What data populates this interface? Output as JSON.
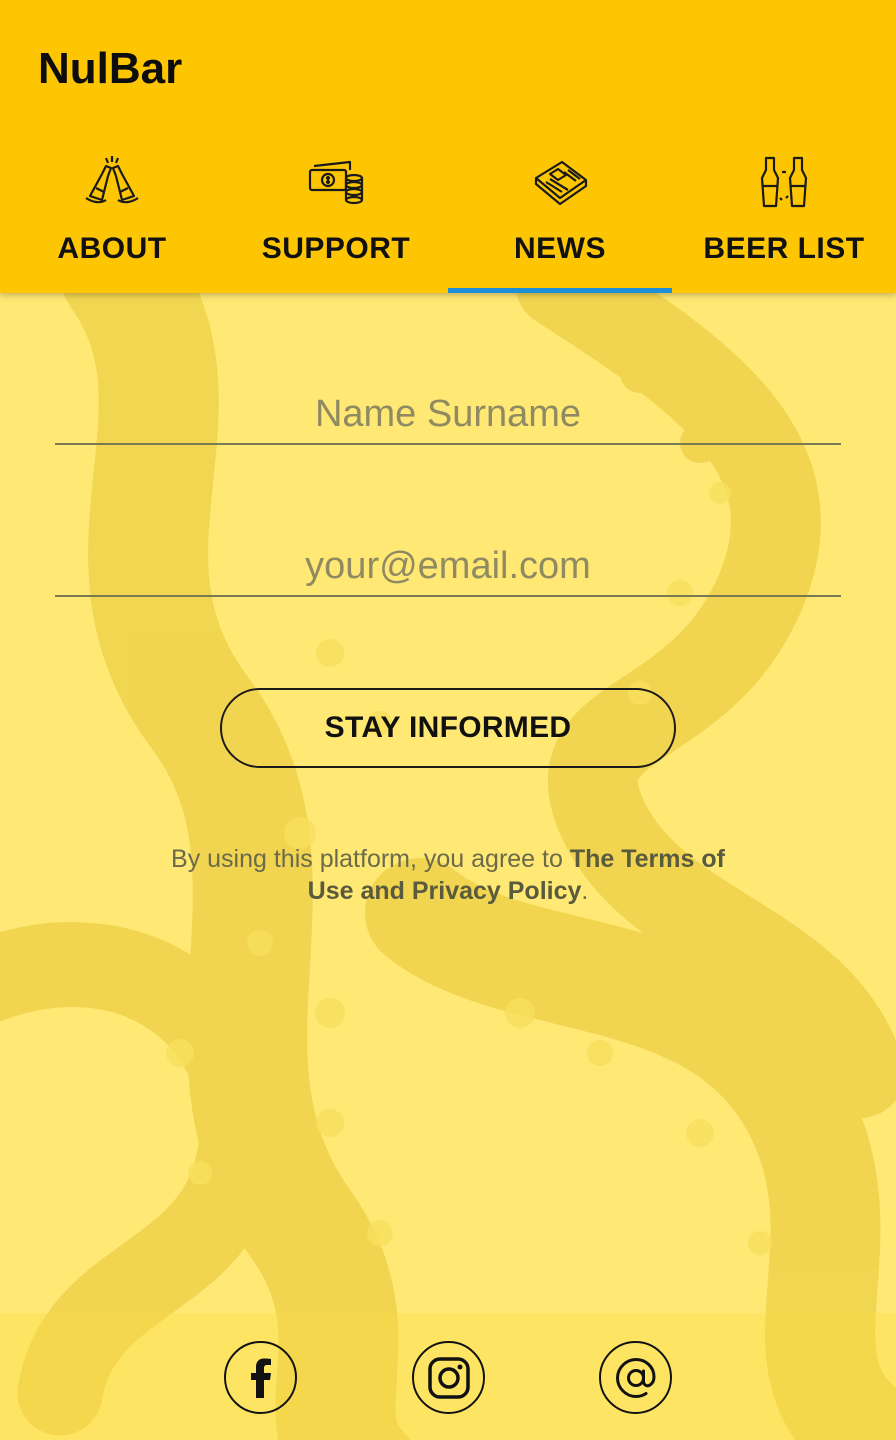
{
  "app": {
    "title": "NulBar"
  },
  "tabs": [
    {
      "label": "ABOUT",
      "icon": "cheers-bottles-icon",
      "active": false
    },
    {
      "label": "SUPPORT",
      "icon": "money-coins-icon",
      "active": false
    },
    {
      "label": "NEWS",
      "icon": "newspaper-icon",
      "active": true
    },
    {
      "label": "BEER LIST",
      "icon": "beer-bottles-icon",
      "active": false
    }
  ],
  "form": {
    "name_placeholder": "Name Surname",
    "email_placeholder": "your@email.com",
    "button_label": "STAY INFORMED"
  },
  "legal": {
    "prefix": "By using this platform, you agree to ",
    "link": "The Terms of Use and Privacy Policy",
    "suffix": "."
  },
  "footer": {
    "social": [
      {
        "icon": "facebook-icon",
        "glyph": "f"
      },
      {
        "icon": "instagram-icon"
      },
      {
        "icon": "email-at-icon",
        "glyph": "@"
      }
    ]
  },
  "colors": {
    "appbar": "#fec602",
    "background": "#ffe874",
    "tab_indicator": "#1e8ed8"
  }
}
